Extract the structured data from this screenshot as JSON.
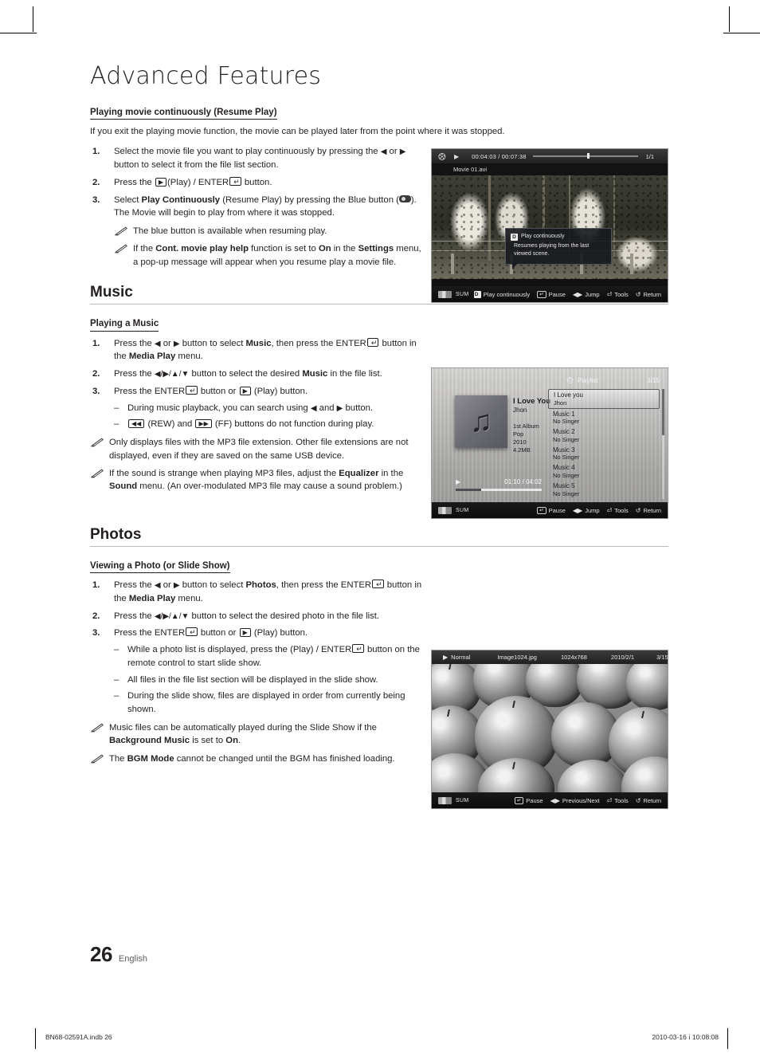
{
  "page": {
    "chapter_title": "Advanced Features",
    "page_number": "26",
    "language": "English"
  },
  "resume_play": {
    "heading": "Playing movie continuously (Resume Play)",
    "lead": "If you exit the playing movie function, the movie can be played later from the point where it was stopped.",
    "steps": [
      {
        "num": "1.",
        "parts": [
          {
            "t": "Select the movie file you want to play continuously by pressing the "
          },
          {
            "t": "◀",
            "style": "arw"
          },
          {
            "t": " or "
          },
          {
            "t": "▶",
            "style": "arw"
          },
          {
            "t": " button to select it from the file list section."
          }
        ]
      },
      {
        "num": "2.",
        "parts": [
          {
            "t": "Press the "
          },
          {
            "t": "▶",
            "style": "key"
          },
          {
            "t": "(Play) / ENTER"
          },
          {
            "t": "↵",
            "style": "key-enter"
          },
          {
            "t": " button."
          }
        ]
      },
      {
        "num": "3.",
        "parts": [
          {
            "t": "Select "
          },
          {
            "t": "Play Continuously",
            "style": "bold"
          },
          {
            "t": " (Resume Play) by pressing the Blue button ("
          },
          {
            "t": "",
            "style": "bluebtn"
          },
          {
            "t": "). The Movie will begin to play from where it was stopped."
          }
        ]
      }
    ],
    "notes": [
      {
        "parts": [
          {
            "t": "The blue button is available when resuming play."
          }
        ]
      },
      {
        "parts": [
          {
            "t": "If the "
          },
          {
            "t": "Cont. movie play help",
            "style": "bold"
          },
          {
            "t": " function is set to "
          },
          {
            "t": "On",
            "style": "bold"
          },
          {
            "t": " in the "
          },
          {
            "t": "Settings",
            "style": "bold"
          },
          {
            "t": " menu, a pop-up message will appear when you resume play a movie file."
          }
        ]
      }
    ]
  },
  "music_section": {
    "title": "Music",
    "heading": "Playing a Music",
    "steps": [
      {
        "num": "1.",
        "parts": [
          {
            "t": "Press the "
          },
          {
            "t": "◀",
            "style": "arw"
          },
          {
            "t": " or "
          },
          {
            "t": "▶",
            "style": "arw"
          },
          {
            "t": " button to select "
          },
          {
            "t": "Music",
            "style": "bold"
          },
          {
            "t": ", then press the ENTER"
          },
          {
            "t": "↵",
            "style": "key-enter"
          },
          {
            "t": " button in the "
          },
          {
            "t": "Media Play",
            "style": "bold"
          },
          {
            "t": " menu."
          }
        ]
      },
      {
        "num": "2.",
        "parts": [
          {
            "t": "Press the "
          },
          {
            "t": "◀/▶/▲/▼",
            "style": "arw"
          },
          {
            "t": " button to select the desired "
          },
          {
            "t": "Music",
            "style": "bold"
          },
          {
            "t": " in the file list."
          }
        ]
      },
      {
        "num": "3.",
        "parts": [
          {
            "t": "Press the ENTER"
          },
          {
            "t": "↵",
            "style": "key-enter"
          },
          {
            "t": " button or "
          },
          {
            "t": "▶",
            "style": "key"
          },
          {
            "t": " (Play) button."
          }
        ],
        "dashes": [
          {
            "parts": [
              {
                "t": "During music playback, you can search using "
              },
              {
                "t": "◀",
                "style": "arw"
              },
              {
                "t": " and "
              },
              {
                "t": "▶",
                "style": "arw"
              },
              {
                "t": " button."
              }
            ]
          },
          {
            "parts": [
              {
                "t": "◀◀",
                "style": "key"
              },
              {
                "t": " (REW) and "
              },
              {
                "t": "▶▶",
                "style": "key"
              },
              {
                "t": " (FF) buttons do not function during play."
              }
            ]
          }
        ]
      }
    ],
    "notes": [
      {
        "parts": [
          {
            "t": "Only displays files with the MP3 file extension. Other file extensions are not displayed, even if they are saved on the same USB device."
          }
        ]
      },
      {
        "parts": [
          {
            "t": "If the sound is strange when playing MP3 files, adjust the "
          },
          {
            "t": "Equalizer",
            "style": "bold"
          },
          {
            "t": " in the "
          },
          {
            "t": "Sound",
            "style": "bold"
          },
          {
            "t": " menu. (An over-modulated MP3 file may cause a sound problem.)"
          }
        ]
      }
    ]
  },
  "photos_section": {
    "title": "Photos",
    "heading": "Viewing a Photo (or Slide Show)",
    "steps": [
      {
        "num": "1.",
        "parts": [
          {
            "t": "Press the "
          },
          {
            "t": "◀",
            "style": "arw"
          },
          {
            "t": " or "
          },
          {
            "t": "▶",
            "style": "arw"
          },
          {
            "t": " button to select "
          },
          {
            "t": "Photos",
            "style": "bold"
          },
          {
            "t": ", then press the ENTER"
          },
          {
            "t": "↵",
            "style": "key-enter"
          },
          {
            "t": " button in the "
          },
          {
            "t": "Media Play",
            "style": "bold"
          },
          {
            "t": " menu."
          }
        ]
      },
      {
        "num": "2.",
        "parts": [
          {
            "t": "Press the "
          },
          {
            "t": "◀/▶/▲/▼",
            "style": "arw"
          },
          {
            "t": " button to select the desired photo in the file list."
          }
        ]
      },
      {
        "num": "3.",
        "parts": [
          {
            "t": "Press the ENTER"
          },
          {
            "t": "↵",
            "style": "key-enter"
          },
          {
            "t": " button or "
          },
          {
            "t": "▶",
            "style": "key"
          },
          {
            "t": " (Play) button."
          }
        ],
        "dashes": [
          {
            "parts": [
              {
                "t": "While a photo list is displayed, press the (Play) / ENTER"
              },
              {
                "t": "↵",
                "style": "key-enter"
              },
              {
                "t": " button on the remote control to start slide show."
              }
            ]
          },
          {
            "parts": [
              {
                "t": "All files in the file list section will be displayed in the slide show."
              }
            ]
          },
          {
            "parts": [
              {
                "t": "During the slide show, files are displayed in order from currently being shown."
              }
            ]
          }
        ]
      }
    ],
    "notes": [
      {
        "parts": [
          {
            "t": "Music files can be automatically played during the Slide Show if the "
          },
          {
            "t": "Background Music",
            "style": "bold"
          },
          {
            "t": " is set to "
          },
          {
            "t": "On",
            "style": "bold"
          },
          {
            "t": "."
          }
        ]
      },
      {
        "parts": [
          {
            "t": "The "
          },
          {
            "t": "BGM Mode",
            "style": "bold"
          },
          {
            "t": " cannot be changed until the BGM has finished loading."
          }
        ]
      }
    ]
  },
  "movie_screenshot": {
    "elapsed_total": "00:04:03 / 00:07:38",
    "counter": "1/1",
    "filename": "Movie 01.avi",
    "popup": {
      "key": "D",
      "title": "Play continuously",
      "body": "Resumes playing from the last viewed scene."
    },
    "source": "SUM",
    "legend": [
      {
        "key": "D",
        "key_style": "solid",
        "label": "Play continuously"
      },
      {
        "key": "↵",
        "key_style": "outline",
        "label": "Pause"
      },
      {
        "key": "◀▶",
        "key_style": "none",
        "label": "Jump"
      },
      {
        "key": "⏎",
        "key_style": "none",
        "label": "Tools"
      },
      {
        "key": "↺",
        "key_style": "none",
        "label": "Return"
      }
    ]
  },
  "music_screenshot": {
    "playlist_label": "Playlist",
    "playlist_counter": "3/15",
    "now_playing": {
      "title": "I Love You",
      "artist": "Jhon",
      "album": "1st Album",
      "genre": "Pop",
      "year": "2010",
      "size": "4.2MB",
      "time": "01:10 / 04:02"
    },
    "tracks": [
      {
        "name": "I Love you",
        "singer": "Jhon",
        "selected": true
      },
      {
        "name": "Music 1",
        "singer": "No Singer",
        "selected": false
      },
      {
        "name": "Music 2",
        "singer": "No Singer",
        "selected": false
      },
      {
        "name": "Music 3",
        "singer": "No Singer",
        "selected": false
      },
      {
        "name": "Music 4",
        "singer": "No Singer",
        "selected": false
      },
      {
        "name": "Music 5",
        "singer": "No Singer",
        "selected": false
      }
    ],
    "source": "SUM",
    "legend": [
      {
        "key": "↵",
        "key_style": "outline",
        "label": "Pause"
      },
      {
        "key": "◀▶",
        "key_style": "none",
        "label": "Jump"
      },
      {
        "key": "⏎",
        "key_style": "none",
        "label": "Tools"
      },
      {
        "key": "↺",
        "key_style": "none",
        "label": "Return"
      }
    ]
  },
  "photo_screenshot": {
    "mode": "Normal",
    "filename": "Image1024.jpg",
    "dimensions": "1024x768",
    "date": "2010/2/1",
    "counter": "3/15",
    "source": "SUM",
    "legend": [
      {
        "key": "↵",
        "key_style": "outline",
        "label": "Pause"
      },
      {
        "key": "◀▶",
        "key_style": "none",
        "label": "Previous/Next"
      },
      {
        "key": "⏎",
        "key_style": "none",
        "label": "Tools"
      },
      {
        "key": "↺",
        "key_style": "none",
        "label": "Return"
      }
    ]
  },
  "document_footer": {
    "left": "BN68-02591A.indb   26",
    "right": "2010-03-16   ⅰ 10:08:08"
  }
}
